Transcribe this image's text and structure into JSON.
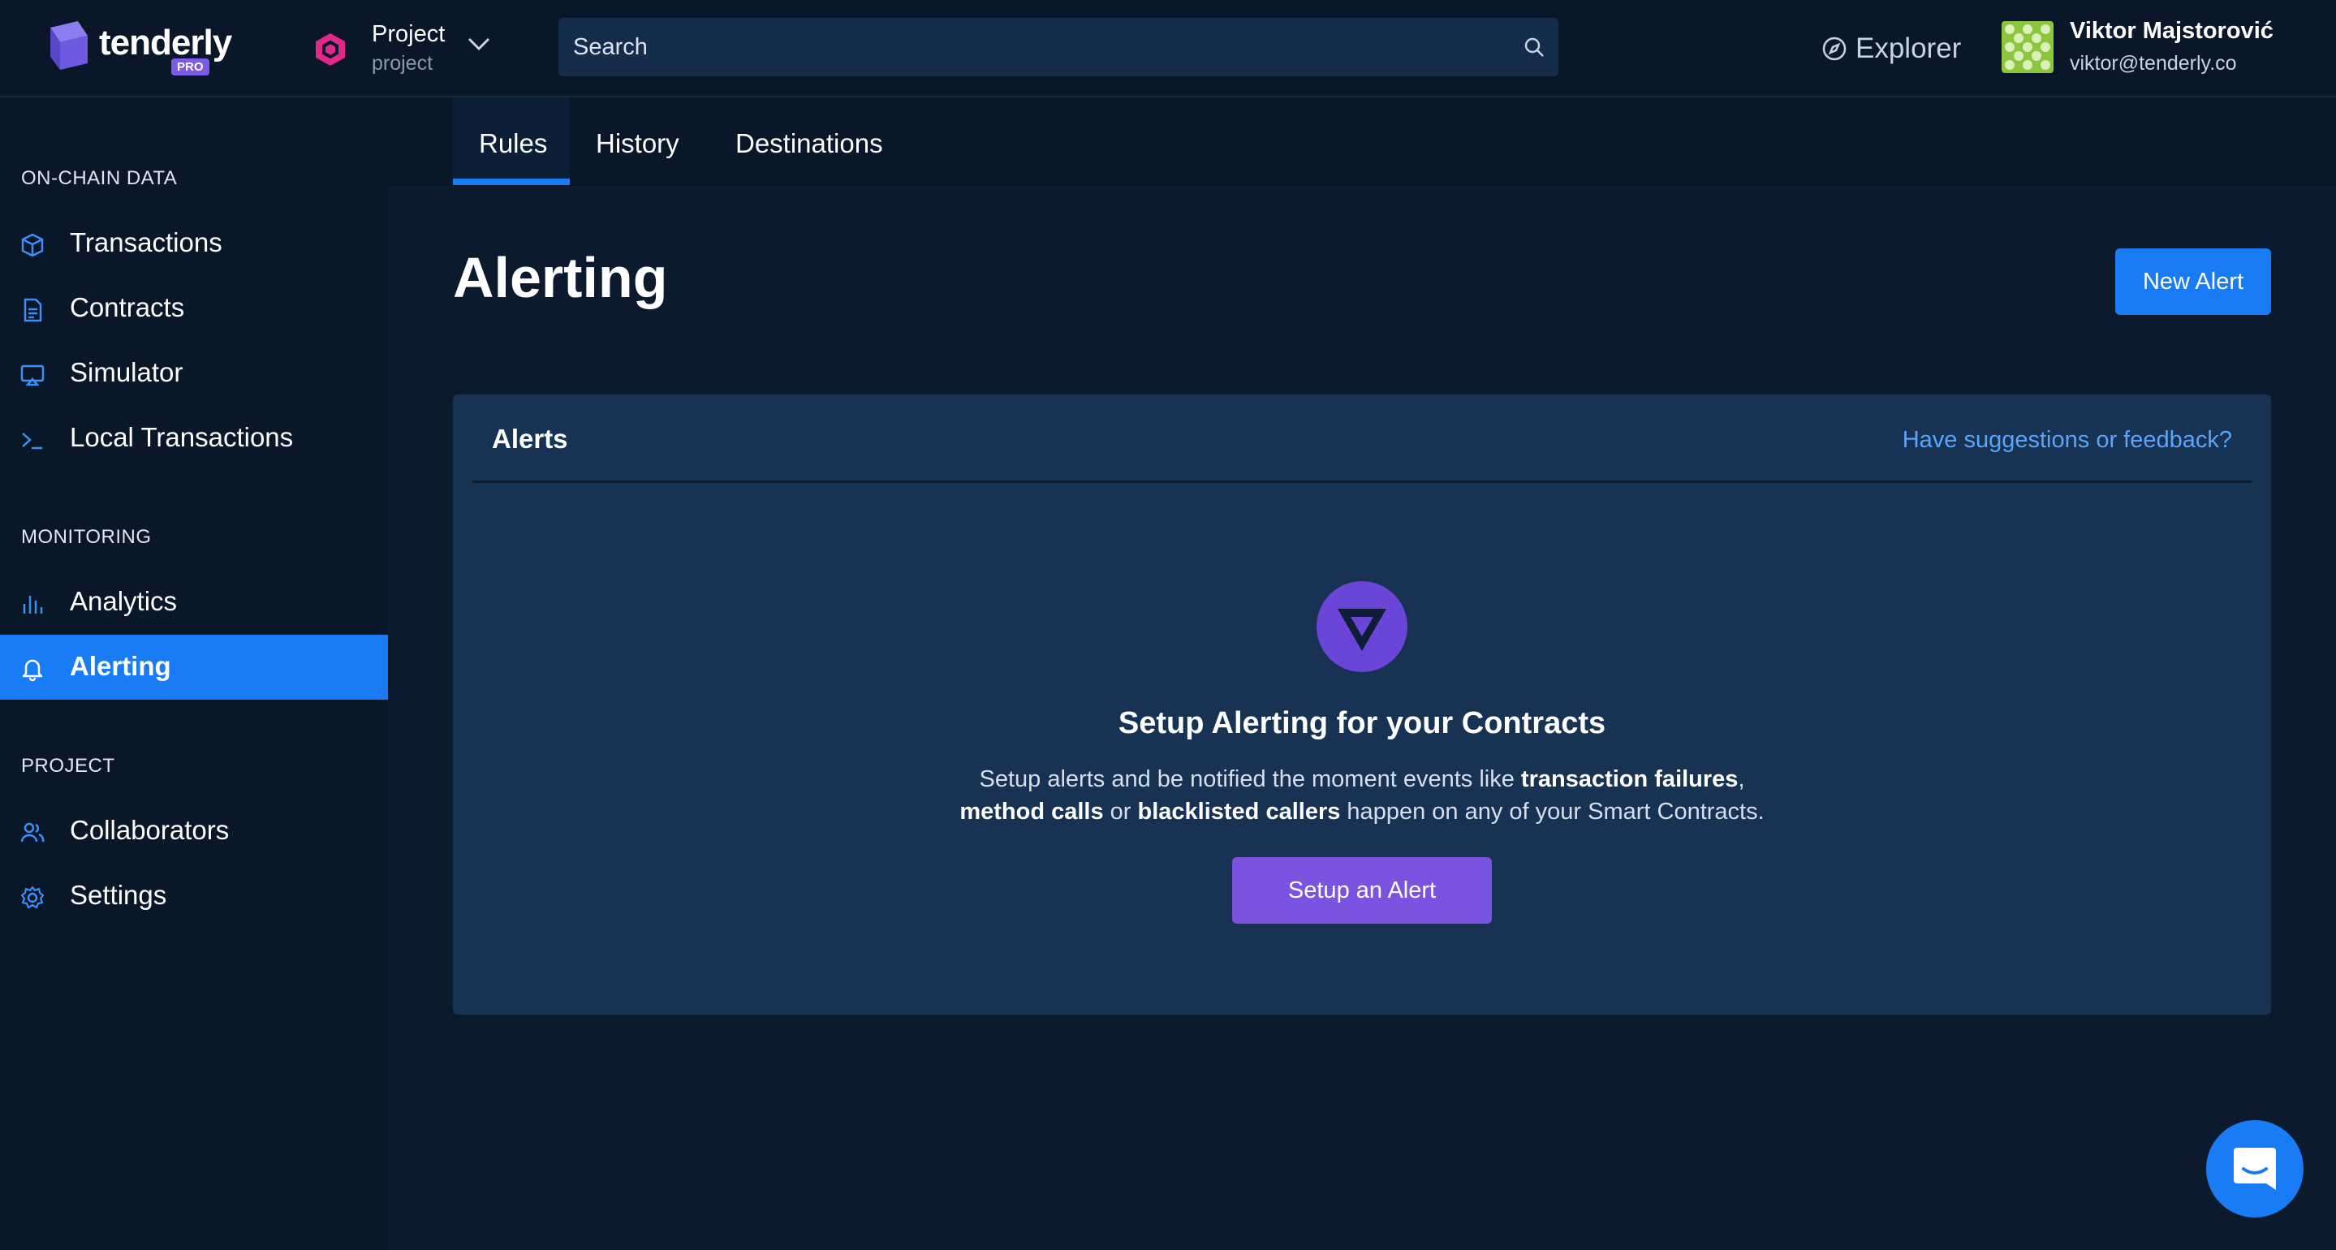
{
  "header": {
    "logo": {
      "text": "tenderly",
      "badge": "PRO"
    },
    "project": {
      "name": "Project",
      "slug": "project"
    },
    "search": {
      "placeholder": "Search"
    },
    "explorer_label": "Explorer",
    "user": {
      "name": "Viktor Majstorović",
      "email": "viktor@tenderly.co"
    }
  },
  "sidebar": {
    "sections": [
      {
        "title": "ON-CHAIN DATA"
      },
      {
        "title": "MONITORING"
      },
      {
        "title": "PROJECT"
      }
    ],
    "items": [
      {
        "label": "Transactions",
        "icon": "cube-icon"
      },
      {
        "label": "Contracts",
        "icon": "document-icon"
      },
      {
        "label": "Simulator",
        "icon": "monitor-icon"
      },
      {
        "label": "Local Transactions",
        "icon": "terminal-icon"
      },
      {
        "label": "Analytics",
        "icon": "bar-chart-icon"
      },
      {
        "label": "Alerting",
        "icon": "bell-icon",
        "active": true
      },
      {
        "label": "Collaborators",
        "icon": "users-icon"
      },
      {
        "label": "Settings",
        "icon": "gear-icon"
      }
    ]
  },
  "tabs": [
    {
      "label": "Rules",
      "active": true
    },
    {
      "label": "History"
    },
    {
      "label": "Destinations"
    }
  ],
  "main": {
    "title": "Alerting",
    "new_alert_label": "New Alert",
    "card": {
      "title": "Alerts",
      "feedback_link": "Have suggestions or feedback?",
      "empty_title": "Setup Alerting for your Contracts",
      "desc": {
        "part1": "Setup alerts and be notified the moment events like ",
        "bold1": "transaction failures",
        "part2": ", ",
        "bold2": "method calls",
        "part3": " or ",
        "bold3": "blacklisted callers",
        "part4": " happen on any of your Smart Contracts."
      },
      "setup_button_label": "Setup an Alert"
    }
  },
  "colors": {
    "background": "#0c1a2e",
    "sidebar": "#0a1729",
    "accent": "#1a7cf5",
    "card": "#173253",
    "purple": "#7a54e0",
    "link": "#5aa5f6"
  }
}
